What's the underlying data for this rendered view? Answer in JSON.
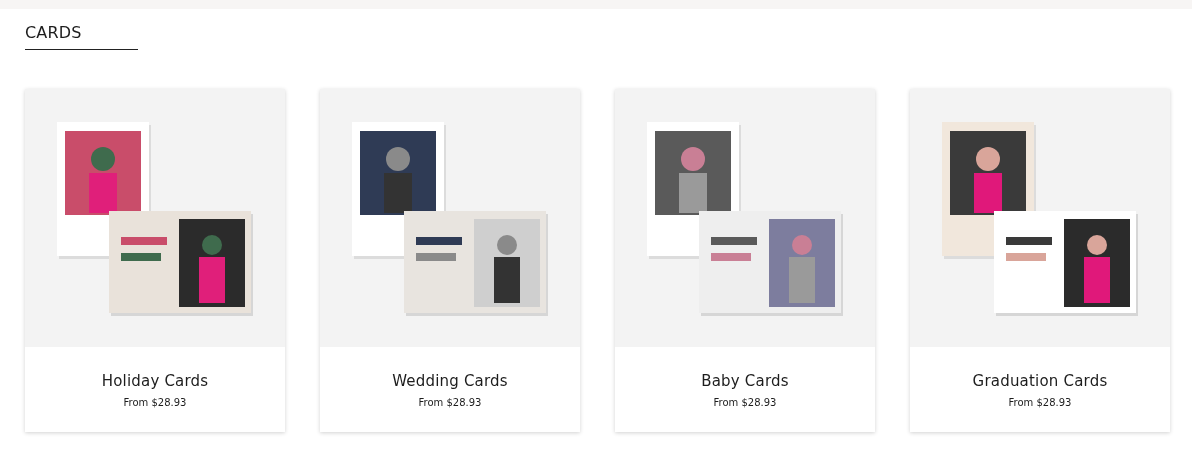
{
  "section": {
    "title": "CARDS"
  },
  "products": [
    {
      "name": "Holiday Cards",
      "price": "From $28.93"
    },
    {
      "name": "Wedding Cards",
      "price": "From $28.93"
    },
    {
      "name": "Baby Cards",
      "price": "From $28.93"
    },
    {
      "name": "Graduation Cards",
      "price": "From $28.93"
    }
  ]
}
